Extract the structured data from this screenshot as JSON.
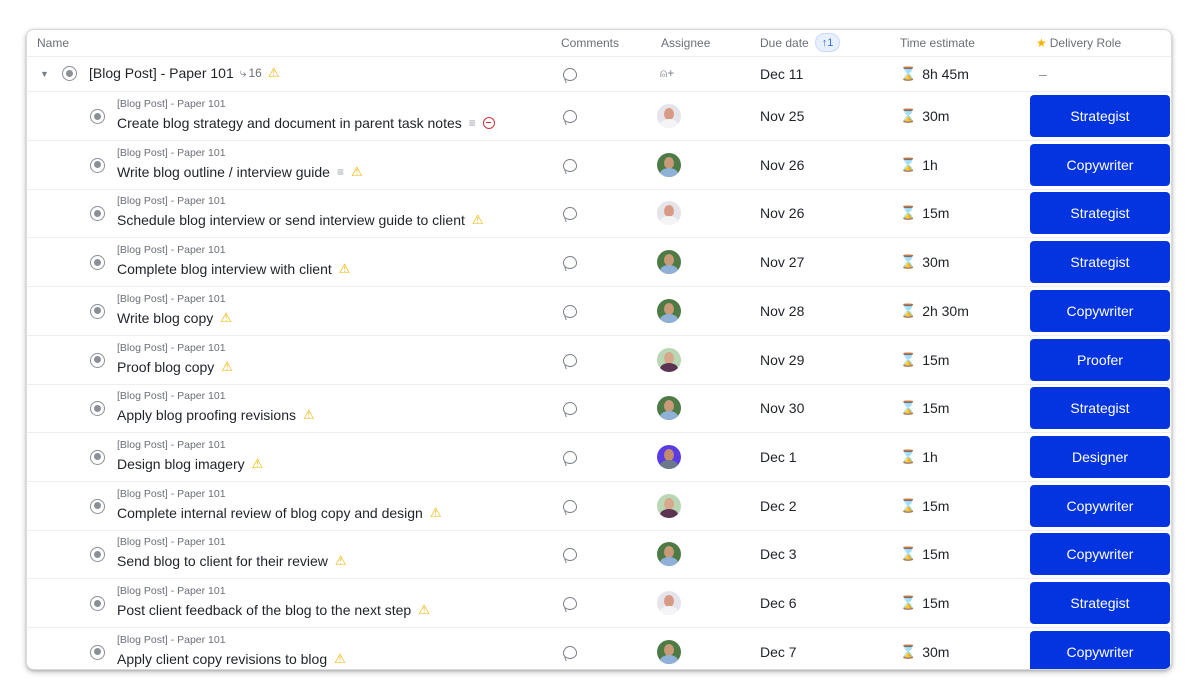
{
  "columns": {
    "name": "Name",
    "comments": "Comments",
    "assignee": "Assignee",
    "due_date": "Due date",
    "due_sort_badge": "↑1",
    "time_estimate": "Time estimate",
    "delivery_role": "Delivery Role"
  },
  "parent": {
    "title": "[Blog Post] - Paper 101",
    "subtask_count": "16",
    "due": "Dec 11",
    "time": "8h 45m",
    "role": "–"
  },
  "tasks": [
    {
      "parent": "[Blog Post] - Paper 101",
      "name": "Create blog strategy and document in parent task notes",
      "has_description": true,
      "blocked": true,
      "warning": false,
      "assignee": "person-a",
      "due": "Nov 25",
      "time": "30m",
      "role": "Strategist"
    },
    {
      "parent": "[Blog Post] - Paper 101",
      "name": "Write blog outline / interview guide",
      "has_description": true,
      "blocked": false,
      "warning": true,
      "assignee": "person-b",
      "due": "Nov 26",
      "time": "1h",
      "role": "Copywriter"
    },
    {
      "parent": "[Blog Post] - Paper 101",
      "name": "Schedule blog interview or send interview guide to client",
      "has_description": false,
      "blocked": false,
      "warning": true,
      "assignee": "person-a",
      "due": "Nov 26",
      "time": "15m",
      "role": "Strategist"
    },
    {
      "parent": "[Blog Post] - Paper 101",
      "name": "Complete blog interview with client",
      "has_description": false,
      "blocked": false,
      "warning": true,
      "assignee": "person-b",
      "due": "Nov 27",
      "time": "30m",
      "role": "Strategist"
    },
    {
      "parent": "[Blog Post] - Paper 101",
      "name": "Write blog copy",
      "has_description": false,
      "blocked": false,
      "warning": true,
      "assignee": "person-b",
      "due": "Nov 28",
      "time": "2h 30m",
      "role": "Copywriter"
    },
    {
      "parent": "[Blog Post] - Paper 101",
      "name": "Proof blog copy",
      "has_description": false,
      "blocked": false,
      "warning": true,
      "assignee": "person-c",
      "due": "Nov 29",
      "time": "15m",
      "role": "Proofer"
    },
    {
      "parent": "[Blog Post] - Paper 101",
      "name": "Apply blog proofing revisions",
      "has_description": false,
      "blocked": false,
      "warning": true,
      "assignee": "person-b",
      "due": "Nov 30",
      "time": "15m",
      "role": "Strategist"
    },
    {
      "parent": "[Blog Post] - Paper 101",
      "name": "Design blog imagery",
      "has_description": false,
      "blocked": false,
      "warning": true,
      "assignee": "person-d",
      "due": "Dec 1",
      "time": "1h",
      "role": "Designer"
    },
    {
      "parent": "[Blog Post] - Paper 101",
      "name": "Complete internal review of blog copy and design",
      "has_description": false,
      "blocked": false,
      "warning": true,
      "assignee": "person-c",
      "due": "Dec 2",
      "time": "15m",
      "role": "Copywriter"
    },
    {
      "parent": "[Blog Post] - Paper 101",
      "name": "Send blog to client for their review",
      "has_description": false,
      "blocked": false,
      "warning": true,
      "assignee": "person-b",
      "due": "Dec 3",
      "time": "15m",
      "role": "Copywriter"
    },
    {
      "parent": "[Blog Post] - Paper 101",
      "name": "Post client feedback of the blog to the next step",
      "has_description": false,
      "blocked": false,
      "warning": true,
      "assignee": "person-a",
      "due": "Dec 6",
      "time": "15m",
      "role": "Strategist"
    },
    {
      "parent": "[Blog Post] - Paper 101",
      "name": "Apply client copy revisions to blog",
      "has_description": false,
      "blocked": false,
      "warning": true,
      "assignee": "person-b",
      "due": "Dec 7",
      "time": "30m",
      "role": "Copywriter"
    }
  ],
  "icons": {
    "warning": "⚠",
    "description": "≡",
    "hourglass": "⌛",
    "star": "★",
    "caret": "▼",
    "subtasks": "⤷",
    "add_assignee": "⍝+"
  },
  "colors": {
    "role_button": "#0433e0",
    "warning": "#f0b400",
    "blocked": "#d1313b"
  }
}
